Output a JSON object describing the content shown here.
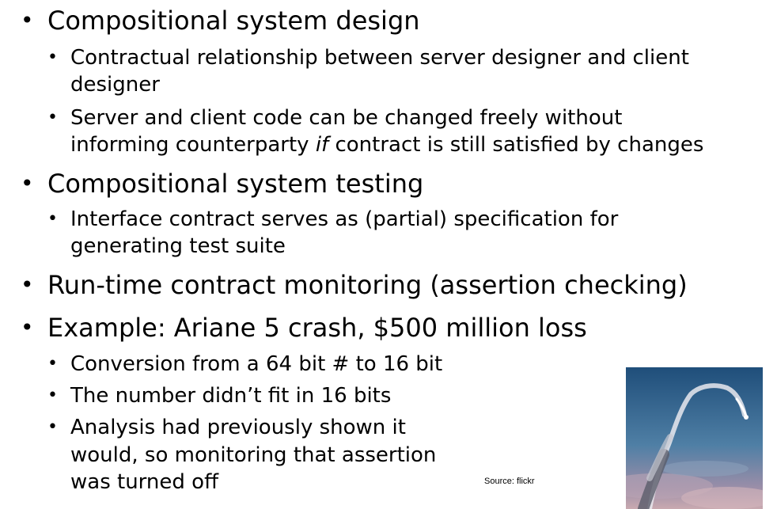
{
  "bullets": {
    "b1": "Compositional system design",
    "b1_sub1_line1": "Contractual relationship between server designer and client",
    "b1_sub1_line2": "designer",
    "b1_sub2_line1": "Server and client code can be changed freely without",
    "b1_sub2_line2_pre": "informing counterparty ",
    "b1_sub2_line2_em": "if",
    "b1_sub2_line2_post": " contract is still satisfied by changes",
    "b2": "Compositional system testing",
    "b2_sub1_line1": "Interface contract serves as (partial) specification for",
    "b2_sub1_line2": "generating test suite",
    "b3": "Run-time contract monitoring (assertion checking)",
    "b4": "Example: Ariane 5 crash, $500 million loss",
    "b4_sub1": "Conversion from a 64 bit # to 16 bit",
    "b4_sub2": "The number didn’t fit in 16 bits",
    "b4_sub3_line1": "Analysis had previously shown it",
    "b4_sub3_line2": "would, so monitoring that assertion",
    "b4_sub3_line3": "was turned off"
  },
  "bullet_glyph": "•",
  "source_caption": "Source: flickr",
  "photo_icon": "rocket-launch-photo"
}
